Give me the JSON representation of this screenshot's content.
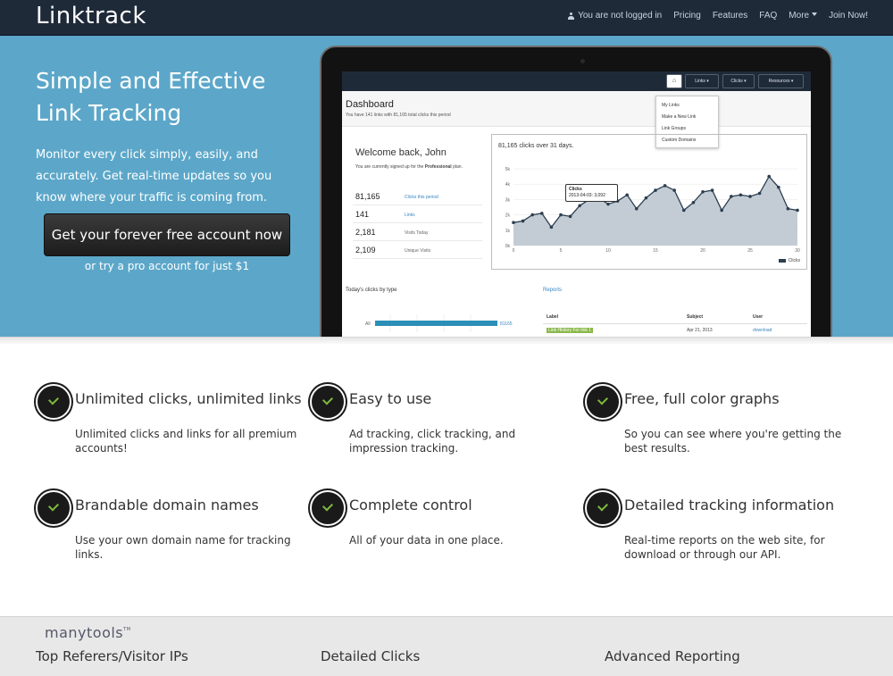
{
  "navbar": {
    "brand": "Linktrack",
    "user_status": "You are not logged in",
    "items": [
      "Pricing",
      "Features",
      "FAQ",
      "More",
      "Join Now!"
    ]
  },
  "hero": {
    "title": "Simple and Effective Link Tracking",
    "description": "Monitor every click simply, easily, and accurately. Get real-time updates so you know where your traffic is coming from.",
    "cta_label": "Get your forever free account now",
    "alt_label": "or try a pro account for just $1"
  },
  "screenshot": {
    "nav_buttons": [
      "Links",
      "Clicks",
      "Resources"
    ],
    "dropdown_items": [
      "My Links",
      "Make a New Link",
      "Link Groups",
      "Custom Domains"
    ],
    "dashboard_title": "Dashboard",
    "dashboard_sub": "You have 141 links with 81,165 total clicks this period",
    "welcome": "Welcome back, John",
    "plan_text": "You are currently signed up for the",
    "plan_name": "Professional",
    "plan_suffix": "plan.",
    "stats": [
      {
        "value": "81,165",
        "label": "Clicks this period"
      },
      {
        "value": "141",
        "label": "Links"
      },
      {
        "value": "2,181",
        "label": "Visits Today"
      },
      {
        "value": "2,109",
        "label": "Unique Visits"
      }
    ],
    "chart_title": "81,165 clicks over 31 days.",
    "tooltip_title": "Clicks",
    "tooltip_value": "2013-04-03: 3,092",
    "legend_label": "Clicks",
    "today_title": "Today's clicks by type",
    "today_row_label": "All",
    "today_row_value": "81165",
    "reports_title": "Reports",
    "reports_headers": [
      "Label",
      "Subject",
      "User"
    ],
    "reports_row": {
      "label": "Link History For link 1",
      "subject": "Apr 21, 2013",
      "user": "download"
    }
  },
  "chart_data": {
    "type": "area",
    "title": "81,165 clicks over 31 days.",
    "x": [
      0,
      1,
      2,
      3,
      4,
      5,
      6,
      7,
      8,
      9,
      10,
      11,
      12,
      13,
      14,
      15,
      16,
      17,
      18,
      19,
      20,
      21,
      22,
      23,
      24,
      25,
      26,
      27,
      28,
      29,
      30
    ],
    "series": [
      {
        "name": "Clicks",
        "values": [
          1500,
          1600,
          2000,
          2100,
          1200,
          2000,
          1900,
          2600,
          3000,
          3100,
          2700,
          2900,
          3300,
          2400,
          3100,
          3600,
          3900,
          3600,
          2300,
          2800,
          3500,
          3600,
          2300,
          3200,
          3300,
          3200,
          3400,
          4500,
          3800,
          2400,
          2300
        ]
      }
    ],
    "xticks": [
      0,
      5,
      10,
      15,
      20,
      25,
      30
    ],
    "yticks": [
      "0k",
      "1k",
      "2k",
      "3k",
      "4k",
      "5k"
    ],
    "ylim": [
      0,
      5000
    ],
    "legend_position": "bottom-right"
  },
  "features": [
    {
      "title": "Unlimited clicks, unlimited links",
      "desc": "Unlimited clicks and links for all premium accounts!"
    },
    {
      "title": "Easy to use",
      "desc": "Ad tracking, click tracking, and impression tracking."
    },
    {
      "title": "Free, full color graphs",
      "desc": "So you can see where you're getting the best results."
    },
    {
      "title": "Brandable domain names",
      "desc": "Use your own domain name for tracking links."
    },
    {
      "title": "Complete control",
      "desc": "All of your data in one place."
    },
    {
      "title": "Detailed tracking information",
      "desc": "Real-time reports on the web site, for download or through our API."
    }
  ],
  "footer": {
    "logo": "manytools",
    "logo_tm": "TM",
    "columns": [
      "Top Referers/Visitor IPs",
      "Detailed Clicks",
      "Advanced Reporting"
    ]
  },
  "colors": {
    "navbar": "#1f2a39",
    "hero": "#5ca7c9",
    "check_accent": "#7dba3f",
    "link": "#3a86c1"
  }
}
